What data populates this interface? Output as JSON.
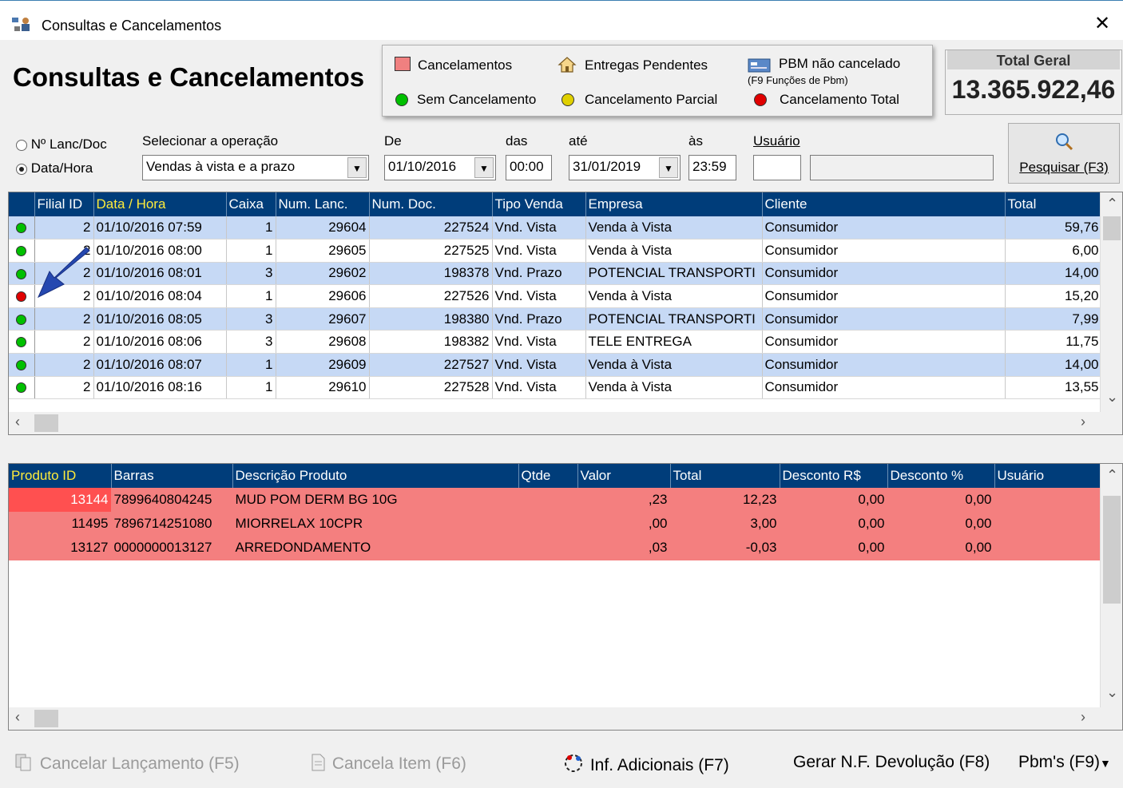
{
  "window": {
    "title": "Consultas e Cancelamentos",
    "close": "✕"
  },
  "header": {
    "title": "Consultas e Cancelamentos"
  },
  "legend": {
    "cancelamentos": "Cancelamentos",
    "entregas": "Entregas Pendentes",
    "pbm": "PBM não cancelado",
    "pbm_sub": "(F9 Funções de Pbm)",
    "sem": "Sem Cancelamento",
    "parcial": "Cancelamento Parcial",
    "total": "Cancelamento Total",
    "colors": {
      "green": "#00c000",
      "yellow": "#e0d000",
      "red": "#e00000",
      "pink": "#f47f7f"
    }
  },
  "total_geral": {
    "label": "Total Geral",
    "value": "13.365.922,46"
  },
  "filters": {
    "radio_lanc": "Nº Lanc/Doc",
    "radio_data": "Data/Hora",
    "operacao_label": "Selecionar a operação",
    "operacao_value": "Vendas à vista e a prazo",
    "de_label": "De",
    "de_value": "01/10/2016",
    "das_label": "das",
    "das_value": "00:00",
    "ate_label": "até",
    "ate_value": "31/01/2019",
    "as_label": "às",
    "as_value": "23:59",
    "usuario_label": "Usuário",
    "usuario_value": "",
    "pesquisar": "Pesquisar (F3)"
  },
  "sales": {
    "headers": [
      "Filial ID",
      "Data / Hora",
      "Caixa",
      "Num. Lanc.",
      "Num. Doc.",
      "Tipo Venda",
      "Empresa",
      "Cliente",
      "Total"
    ],
    "rows": [
      {
        "status": "green",
        "filial": "2",
        "data": "01/10/2016 07:59",
        "caixa": "1",
        "lanc": "29604",
        "doc": "227524",
        "tipo": "Vnd. Vista",
        "empresa": "Venda à Vista",
        "cliente": "Consumidor",
        "total": "59,76"
      },
      {
        "status": "green",
        "filial": "2",
        "data": "01/10/2016 08:00",
        "caixa": "1",
        "lanc": "29605",
        "doc": "227525",
        "tipo": "Vnd. Vista",
        "empresa": "Venda à Vista",
        "cliente": "Consumidor",
        "total": "6,00"
      },
      {
        "status": "green",
        "filial": "2",
        "data": "01/10/2016 08:01",
        "caixa": "3",
        "lanc": "29602",
        "doc": "198378",
        "tipo": "Vnd. Prazo",
        "empresa": "POTENCIAL TRANSPORTI",
        "cliente": "Consumidor",
        "total": "14,00"
      },
      {
        "status": "red",
        "filial": "2",
        "data": "01/10/2016 08:04",
        "caixa": "1",
        "lanc": "29606",
        "doc": "227526",
        "tipo": "Vnd. Vista",
        "empresa": "Venda à Vista",
        "cliente": "Consumidor",
        "total": "15,20"
      },
      {
        "status": "green",
        "filial": "2",
        "data": "01/10/2016 08:05",
        "caixa": "3",
        "lanc": "29607",
        "doc": "198380",
        "tipo": "Vnd. Prazo",
        "empresa": "POTENCIAL TRANSPORTI",
        "cliente": "Consumidor",
        "total": "7,99"
      },
      {
        "status": "green",
        "filial": "2",
        "data": "01/10/2016 08:06",
        "caixa": "3",
        "lanc": "29608",
        "doc": "198382",
        "tipo": "Vnd. Vista",
        "empresa": "TELE ENTREGA",
        "cliente": "Consumidor",
        "total": "11,75"
      },
      {
        "status": "green",
        "filial": "2",
        "data": "01/10/2016 08:07",
        "caixa": "1",
        "lanc": "29609",
        "doc": "227527",
        "tipo": "Vnd. Vista",
        "empresa": "Venda à Vista",
        "cliente": "Consumidor",
        "total": "14,00"
      },
      {
        "status": "green",
        "filial": "2",
        "data": "01/10/2016 08:16",
        "caixa": "1",
        "lanc": "29610",
        "doc": "227528",
        "tipo": "Vnd. Vista",
        "empresa": "Venda à Vista",
        "cliente": "Consumidor",
        "total": "13,55"
      }
    ]
  },
  "items": {
    "headers": [
      "Produto ID",
      "Barras",
      "Descrição Produto",
      "Qtde",
      "Valor",
      "Total",
      "Desconto R$",
      "Desconto %",
      "Usuário"
    ],
    "rows": [
      {
        "id": "13144",
        "barras": "7899640804245",
        "desc": "MUD POM DERM BG 10G",
        "qtde": "",
        "valor": ",23",
        "total": "12,23",
        "desc_rs": "0,00",
        "desc_pct": "0,00",
        "usuario": ""
      },
      {
        "id": "11495",
        "barras": "7896714251080",
        "desc": "MIORRELAX 10CPR",
        "qtde": "",
        "valor": ",00",
        "total": "3,00",
        "desc_rs": "0,00",
        "desc_pct": "0,00",
        "usuario": ""
      },
      {
        "id": "13127",
        "barras": "0000000013127",
        "desc": "ARREDONDAMENTO",
        "qtde": "",
        "valor": ",03",
        "total": "-0,03",
        "desc_rs": "0,00",
        "desc_pct": "0,00",
        "usuario": ""
      }
    ]
  },
  "footer": {
    "cancelar": "Cancelar Lançamento (F5)",
    "cancela_item": "Cancela Item (F6)",
    "inf": "Inf. Adicionais (F7)",
    "gerar": "Gerar N.F. Devolução (F8)",
    "pbms": "Pbm's (F9)"
  }
}
